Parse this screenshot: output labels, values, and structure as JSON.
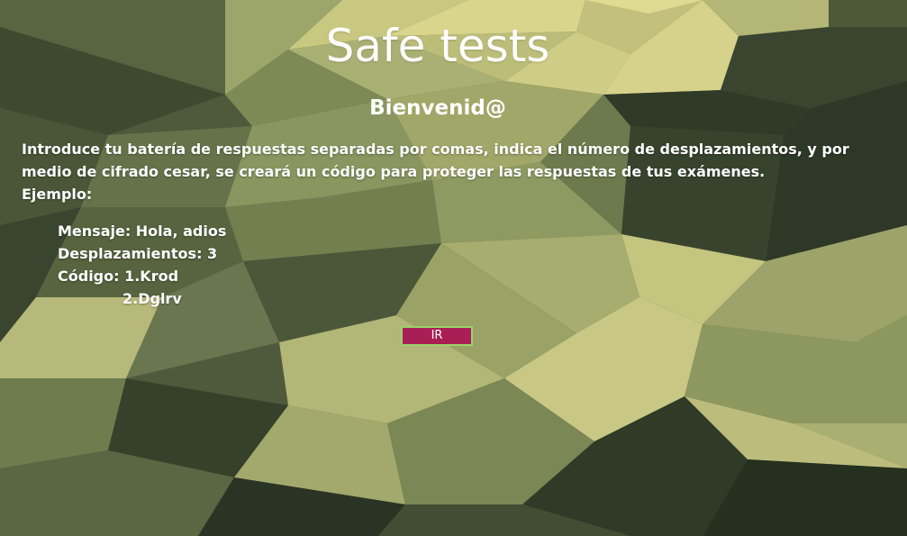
{
  "page": {
    "title": "Safe tests",
    "subtitle": "Bienvenid@"
  },
  "intro": {
    "line1": "Introduce tu batería de respuestas separadas por comas, indica el número de desplazamientos, y por",
    "line2": "medio de cifrado cesar, se creará un código para proteger las respuestas de tus exámenes.",
    "example_heading": "Ejemplo:"
  },
  "example": {
    "message": "Mensaje: Hola, adios",
    "shifts": "Desplazamientos: 3",
    "code_line1": "Código: 1.Krod",
    "code_line2": "2.Dglrv"
  },
  "button": {
    "label": "IR"
  },
  "colors": {
    "button_bg": "#a81e55",
    "button_border": "#9bd36b",
    "background_dark": "#26301f",
    "background_light": "#d8d48a"
  }
}
